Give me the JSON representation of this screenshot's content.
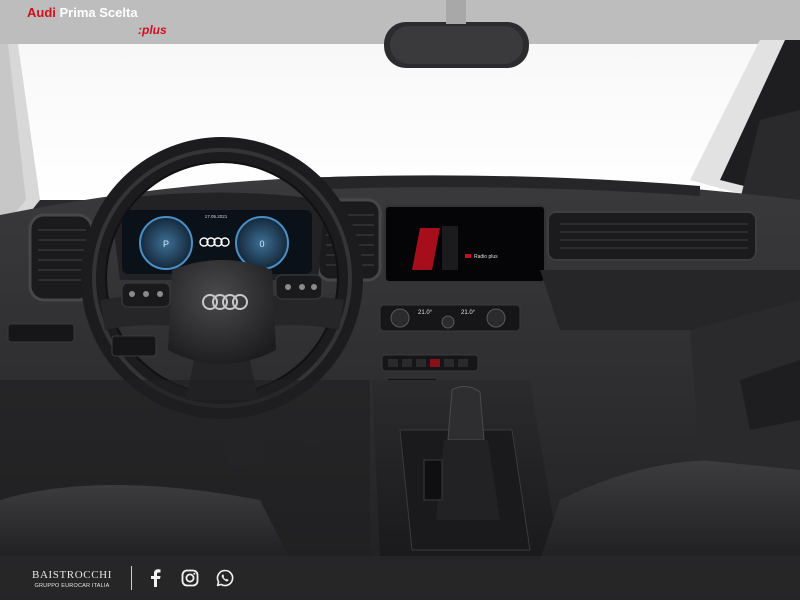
{
  "brand": {
    "audi": "Audi",
    "program": "Prima Scelta",
    "plus": ":plus"
  },
  "cluster": {
    "date": "17.05.2021"
  },
  "climate": {
    "left_temp": "21.0°",
    "right_temp": "21.0°"
  },
  "infotainment": {
    "source_label": "Radio plus"
  },
  "dealer": {
    "name": "BAISTROCCHI",
    "tagline": "GRUPPO EUROCAR ITALIA"
  },
  "social": [
    {
      "icon": "facebook-icon"
    },
    {
      "icon": "instagram-icon"
    },
    {
      "icon": "whatsapp-icon"
    }
  ],
  "colors": {
    "brand_red": "#d10f1c",
    "footer_bg": "#28282a",
    "screen_accent": "#c41020",
    "cluster_blue": "#4a90c8"
  }
}
